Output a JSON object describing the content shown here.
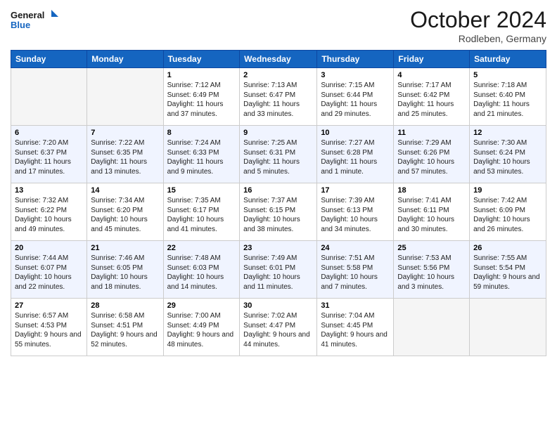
{
  "logo": {
    "text_general": "General",
    "text_blue": "Blue"
  },
  "header": {
    "month": "October 2024",
    "location": "Rodleben, Germany"
  },
  "weekdays": [
    "Sunday",
    "Monday",
    "Tuesday",
    "Wednesday",
    "Thursday",
    "Friday",
    "Saturday"
  ],
  "weeks": [
    [
      {
        "day": "",
        "empty": true
      },
      {
        "day": "",
        "empty": true
      },
      {
        "day": "1",
        "sunrise": "7:12 AM",
        "sunset": "6:49 PM",
        "daylight": "11 hours and 37 minutes."
      },
      {
        "day": "2",
        "sunrise": "7:13 AM",
        "sunset": "6:47 PM",
        "daylight": "11 hours and 33 minutes."
      },
      {
        "day": "3",
        "sunrise": "7:15 AM",
        "sunset": "6:44 PM",
        "daylight": "11 hours and 29 minutes."
      },
      {
        "day": "4",
        "sunrise": "7:17 AM",
        "sunset": "6:42 PM",
        "daylight": "11 hours and 25 minutes."
      },
      {
        "day": "5",
        "sunrise": "7:18 AM",
        "sunset": "6:40 PM",
        "daylight": "11 hours and 21 minutes."
      }
    ],
    [
      {
        "day": "6",
        "sunrise": "7:20 AM",
        "sunset": "6:37 PM",
        "daylight": "11 hours and 17 minutes."
      },
      {
        "day": "7",
        "sunrise": "7:22 AM",
        "sunset": "6:35 PM",
        "daylight": "11 hours and 13 minutes."
      },
      {
        "day": "8",
        "sunrise": "7:24 AM",
        "sunset": "6:33 PM",
        "daylight": "11 hours and 9 minutes."
      },
      {
        "day": "9",
        "sunrise": "7:25 AM",
        "sunset": "6:31 PM",
        "daylight": "11 hours and 5 minutes."
      },
      {
        "day": "10",
        "sunrise": "7:27 AM",
        "sunset": "6:28 PM",
        "daylight": "11 hours and 1 minute."
      },
      {
        "day": "11",
        "sunrise": "7:29 AM",
        "sunset": "6:26 PM",
        "daylight": "10 hours and 57 minutes."
      },
      {
        "day": "12",
        "sunrise": "7:30 AM",
        "sunset": "6:24 PM",
        "daylight": "10 hours and 53 minutes."
      }
    ],
    [
      {
        "day": "13",
        "sunrise": "7:32 AM",
        "sunset": "6:22 PM",
        "daylight": "10 hours and 49 minutes."
      },
      {
        "day": "14",
        "sunrise": "7:34 AM",
        "sunset": "6:20 PM",
        "daylight": "10 hours and 45 minutes."
      },
      {
        "day": "15",
        "sunrise": "7:35 AM",
        "sunset": "6:17 PM",
        "daylight": "10 hours and 41 minutes."
      },
      {
        "day": "16",
        "sunrise": "7:37 AM",
        "sunset": "6:15 PM",
        "daylight": "10 hours and 38 minutes."
      },
      {
        "day": "17",
        "sunrise": "7:39 AM",
        "sunset": "6:13 PM",
        "daylight": "10 hours and 34 minutes."
      },
      {
        "day": "18",
        "sunrise": "7:41 AM",
        "sunset": "6:11 PM",
        "daylight": "10 hours and 30 minutes."
      },
      {
        "day": "19",
        "sunrise": "7:42 AM",
        "sunset": "6:09 PM",
        "daylight": "10 hours and 26 minutes."
      }
    ],
    [
      {
        "day": "20",
        "sunrise": "7:44 AM",
        "sunset": "6:07 PM",
        "daylight": "10 hours and 22 minutes."
      },
      {
        "day": "21",
        "sunrise": "7:46 AM",
        "sunset": "6:05 PM",
        "daylight": "10 hours and 18 minutes."
      },
      {
        "day": "22",
        "sunrise": "7:48 AM",
        "sunset": "6:03 PM",
        "daylight": "10 hours and 14 minutes."
      },
      {
        "day": "23",
        "sunrise": "7:49 AM",
        "sunset": "6:01 PM",
        "daylight": "10 hours and 11 minutes."
      },
      {
        "day": "24",
        "sunrise": "7:51 AM",
        "sunset": "5:58 PM",
        "daylight": "10 hours and 7 minutes."
      },
      {
        "day": "25",
        "sunrise": "7:53 AM",
        "sunset": "5:56 PM",
        "daylight": "10 hours and 3 minutes."
      },
      {
        "day": "26",
        "sunrise": "7:55 AM",
        "sunset": "5:54 PM",
        "daylight": "9 hours and 59 minutes."
      }
    ],
    [
      {
        "day": "27",
        "sunrise": "6:57 AM",
        "sunset": "4:53 PM",
        "daylight": "9 hours and 55 minutes."
      },
      {
        "day": "28",
        "sunrise": "6:58 AM",
        "sunset": "4:51 PM",
        "daylight": "9 hours and 52 minutes."
      },
      {
        "day": "29",
        "sunrise": "7:00 AM",
        "sunset": "4:49 PM",
        "daylight": "9 hours and 48 minutes."
      },
      {
        "day": "30",
        "sunrise": "7:02 AM",
        "sunset": "4:47 PM",
        "daylight": "9 hours and 44 minutes."
      },
      {
        "day": "31",
        "sunrise": "7:04 AM",
        "sunset": "4:45 PM",
        "daylight": "9 hours and 41 minutes."
      },
      {
        "day": "",
        "empty": true
      },
      {
        "day": "",
        "empty": true
      }
    ]
  ]
}
